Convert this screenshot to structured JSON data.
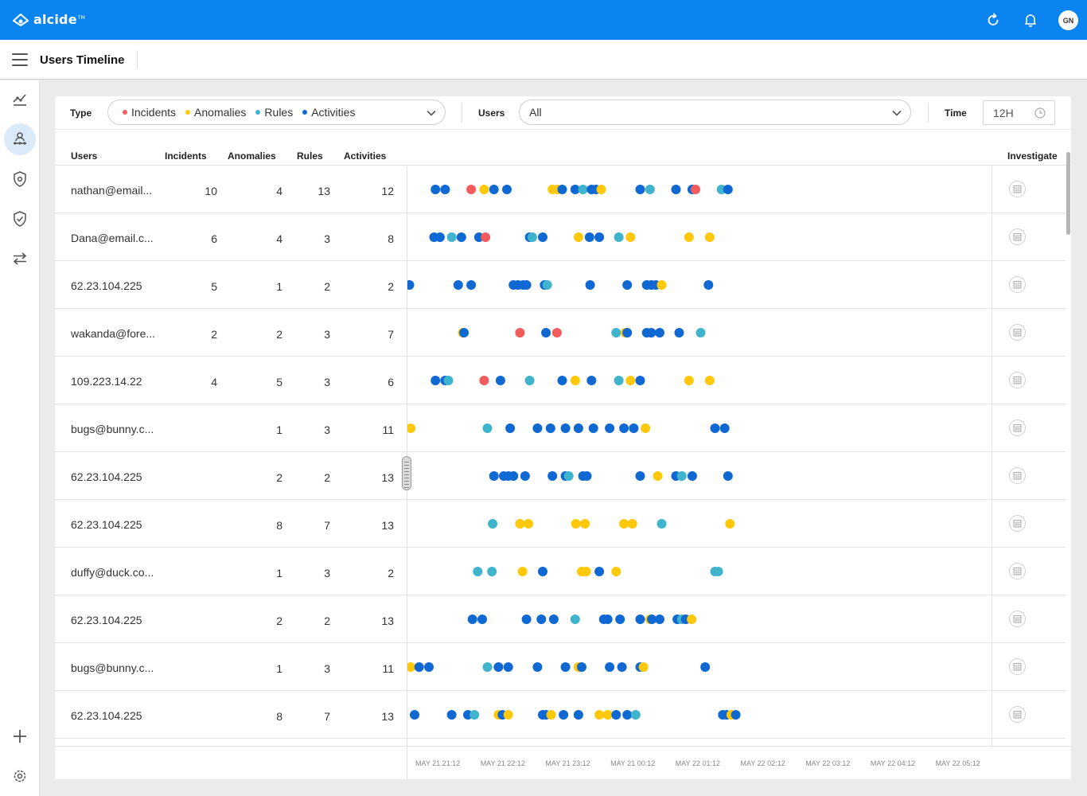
{
  "app": {
    "brand": "alcide",
    "brand_mark": "TM",
    "avatar_initials": "GN",
    "page_title": "Users Timeline"
  },
  "topbar_icons": [
    "refresh-icon",
    "bell-icon"
  ],
  "sidebar_icons": [
    "analytics-icon",
    "users-timeline-icon",
    "shield-gear-icon",
    "shield-check-icon",
    "transfer-icon",
    "plus-icon",
    "settings-icon"
  ],
  "filters": {
    "type_label": "Type",
    "legend": [
      {
        "label": "Incidents",
        "color": "#f25c5c"
      },
      {
        "label": "Anomalies",
        "color": "#ffc80a"
      },
      {
        "label": "Rules",
        "color": "#40b4cc"
      },
      {
        "label": "Activities",
        "color": "#1068d2"
      }
    ],
    "users_label": "Users",
    "users_value": "All",
    "time_label": "Time",
    "time_value": "12H"
  },
  "table": {
    "headers": {
      "users": "Users",
      "incidents": "Incidents",
      "anomalies": "Anomalies",
      "rules": "Rules",
      "activities": "Activities",
      "investigate": "Investigate"
    },
    "rows": [
      {
        "user": "nathan@email...",
        "incidents": "10",
        "anomalies": "4",
        "rules": "13",
        "activities": "12"
      },
      {
        "user": "Dana@email.c...",
        "incidents": "6",
        "anomalies": "4",
        "rules": "3",
        "activities": "8"
      },
      {
        "user": "62.23.104.225",
        "incidents": "5",
        "anomalies": "1",
        "rules": "2",
        "activities": "2"
      },
      {
        "user": "wakanda@fore...",
        "incidents": "2",
        "anomalies": "2",
        "rules": "3",
        "activities": "7"
      },
      {
        "user": "109.223.14.22",
        "incidents": "4",
        "anomalies": "5",
        "rules": "3",
        "activities": "6"
      },
      {
        "user": "bugs@bunny.c...",
        "incidents": "",
        "anomalies": "1",
        "rules": "3",
        "activities": "11"
      },
      {
        "user": "62.23.104.225",
        "incidents": "",
        "anomalies": "2",
        "rules": "2",
        "activities": "13"
      },
      {
        "user": "62.23.104.225",
        "incidents": "",
        "anomalies": "8",
        "rules": "7",
        "activities": "13"
      },
      {
        "user": "duffy@duck.co...",
        "incidents": "",
        "anomalies": "1",
        "rules": "3",
        "activities": "2"
      },
      {
        "user": "62.23.104.225",
        "incidents": "",
        "anomalies": "2",
        "rules": "2",
        "activities": "13"
      },
      {
        "user": "bugs@bunny.c...",
        "incidents": "",
        "anomalies": "1",
        "rules": "3",
        "activities": "11"
      },
      {
        "user": "62.23.104.225",
        "incidents": "",
        "anomalies": "8",
        "rules": "7",
        "activities": "13"
      }
    ]
  },
  "timeline": {
    "axis_labels": [
      "MAY 21 21:12",
      "MAY 21 22:12",
      "MAY 21 23:12",
      "MAY 21 00:12",
      "MAY 22 01:12",
      "MAY 22 02:12",
      "MAY 22 03:12",
      "MAY 22 04:12",
      "MAY 22 05:12"
    ],
    "events": [
      [
        [
          "a",
          21.3
        ],
        [
          "a",
          21.45
        ],
        [
          "i",
          21.85
        ],
        [
          "n",
          22.05
        ],
        [
          "a",
          22.2
        ],
        [
          "a",
          22.4
        ],
        [
          "n",
          23.1
        ],
        [
          "n",
          23.18
        ],
        [
          "a",
          23.25
        ],
        [
          "a",
          23.45
        ],
        [
          "r",
          23.57
        ],
        [
          "a",
          23.7
        ],
        [
          "a",
          23.77
        ],
        [
          "n",
          23.85
        ],
        [
          "a",
          24.45
        ],
        [
          "r",
          24.6
        ],
        [
          "a",
          25.0
        ],
        [
          "a",
          25.25
        ],
        [
          "i",
          25.3
        ],
        [
          "r",
          25.7
        ],
        [
          "a",
          25.8
        ]
      ],
      [
        [
          "a",
          21.28
        ],
        [
          "a",
          21.37
        ],
        [
          "r",
          21.55
        ],
        [
          "a",
          21.7
        ],
        [
          "a",
          21.97
        ],
        [
          "i",
          22.07
        ],
        [
          "a",
          22.75
        ],
        [
          "r",
          22.79
        ],
        [
          "a",
          22.95
        ],
        [
          "n",
          23.5
        ],
        [
          "a",
          23.67
        ],
        [
          "a",
          23.82
        ],
        [
          "r",
          24.12
        ],
        [
          "n",
          24.3
        ],
        [
          "n",
          25.2
        ],
        [
          "n",
          25.52
        ]
      ],
      [
        [
          "a",
          20.75
        ],
        [
          "a",
          20.9
        ],
        [
          "a",
          21.65
        ],
        [
          "a",
          21.85
        ],
        [
          "a",
          22.5
        ],
        [
          "a",
          22.57
        ],
        [
          "a",
          22.65
        ],
        [
          "a",
          22.7
        ],
        [
          "a",
          22.98
        ],
        [
          "r",
          23.02
        ],
        [
          "a",
          23.68
        ],
        [
          "a",
          24.25
        ],
        [
          "a",
          24.55
        ],
        [
          "a",
          24.62
        ],
        [
          "a",
          24.69
        ],
        [
          "n",
          24.78
        ],
        [
          "a",
          25.5
        ]
      ],
      [
        [
          "n",
          21.72
        ],
        [
          "a",
          21.74
        ],
        [
          "i",
          22.6
        ],
        [
          "a",
          23.0
        ],
        [
          "i",
          23.17
        ],
        [
          "r",
          24.08
        ],
        [
          "n",
          24.22
        ],
        [
          "a",
          24.25
        ],
        [
          "a",
          24.55
        ],
        [
          "a",
          24.62
        ],
        [
          "a",
          24.75
        ],
        [
          "a",
          25.05
        ],
        [
          "r",
          25.38
        ]
      ],
      [
        [
          "a",
          21.3
        ],
        [
          "a",
          21.45
        ],
        [
          "r",
          21.5
        ],
        [
          "i",
          22.05
        ],
        [
          "a",
          22.3
        ],
        [
          "r",
          22.75
        ],
        [
          "a",
          23.25
        ],
        [
          "n",
          23.45
        ],
        [
          "a",
          23.7
        ],
        [
          "r",
          24.12
        ],
        [
          "n",
          24.3
        ],
        [
          "a",
          24.45
        ],
        [
          "n",
          25.2
        ],
        [
          "n",
          25.52
        ]
      ],
      [
        [
          "n",
          20.92
        ],
        [
          "r",
          22.1
        ],
        [
          "a",
          22.45
        ],
        [
          "a",
          22.87
        ],
        [
          "a",
          23.07
        ],
        [
          "a",
          23.3
        ],
        [
          "n",
          23.5
        ],
        [
          "a",
          23.5
        ],
        [
          "a",
          23.73
        ],
        [
          "a",
          23.98
        ],
        [
          "a",
          24.2
        ],
        [
          "a",
          24.35
        ],
        [
          "n",
          24.53
        ],
        [
          "a",
          25.6
        ],
        [
          "a",
          25.75
        ]
      ],
      [
        [
          "a",
          22.2
        ],
        [
          "a",
          22.35
        ],
        [
          "a",
          22.42
        ],
        [
          "a",
          22.5
        ],
        [
          "a",
          22.68
        ],
        [
          "a",
          23.1
        ],
        [
          "a",
          23.3
        ],
        [
          "r",
          23.35
        ],
        [
          "a",
          23.57
        ],
        [
          "a",
          23.63
        ],
        [
          "a",
          24.45
        ],
        [
          "n",
          24.72
        ],
        [
          "a",
          25.0
        ],
        [
          "r",
          25.09
        ],
        [
          "a",
          25.25
        ],
        [
          "a",
          25.8
        ]
      ],
      [
        [
          "n",
          20.7
        ],
        [
          "r",
          22.18
        ],
        [
          "n",
          22.6
        ],
        [
          "n",
          22.73
        ],
        [
          "n",
          23.46
        ],
        [
          "n",
          23.6
        ],
        [
          "n",
          24.2
        ],
        [
          "n",
          24.33
        ],
        [
          "r",
          24.78
        ],
        [
          "n",
          25.83
        ]
      ],
      [
        [
          "r",
          21.95
        ],
        [
          "r",
          22.17
        ],
        [
          "n",
          22.64
        ],
        [
          "a",
          22.95
        ],
        [
          "n",
          23.55
        ],
        [
          "n",
          23.62
        ],
        [
          "a",
          23.82
        ],
        [
          "n",
          24.08
        ],
        [
          "r",
          25.6
        ],
        [
          "r",
          25.65
        ]
      ],
      [
        [
          "a",
          21.87
        ],
        [
          "a",
          22.02
        ],
        [
          "a",
          22.7
        ],
        [
          "a",
          22.93
        ],
        [
          "a",
          23.12
        ],
        [
          "r",
          23.45
        ],
        [
          "a",
          23.89
        ],
        [
          "a",
          23.95
        ],
        [
          "a",
          24.14
        ],
        [
          "a",
          24.45
        ],
        [
          "n",
          24.6
        ],
        [
          "a",
          24.63
        ],
        [
          "a",
          24.75
        ],
        [
          "a",
          25.02
        ],
        [
          "r",
          25.09
        ],
        [
          "a",
          25.15
        ],
        [
          "n",
          25.24
        ]
      ],
      [
        [
          "n",
          20.92
        ],
        [
          "a",
          21.05
        ],
        [
          "a",
          21.2
        ],
        [
          "r",
          22.1
        ],
        [
          "a",
          22.27
        ],
        [
          "a",
          22.42
        ],
        [
          "a",
          22.87
        ],
        [
          "a",
          23.3
        ],
        [
          "n",
          23.5
        ],
        [
          "a",
          23.55
        ],
        [
          "a",
          23.98
        ],
        [
          "a",
          24.17
        ],
        [
          "a",
          24.45
        ],
        [
          "n",
          24.5
        ],
        [
          "a",
          25.45
        ]
      ],
      [
        [
          "n",
          20.7
        ],
        [
          "a",
          20.98
        ],
        [
          "a",
          21.55
        ],
        [
          "a",
          21.8
        ],
        [
          "r",
          21.9
        ],
        [
          "n",
          22.27
        ],
        [
          "a",
          22.33
        ],
        [
          "n",
          22.42
        ],
        [
          "a",
          22.95
        ],
        [
          "a",
          23.0
        ],
        [
          "n",
          23.08
        ],
        [
          "a",
          23.27
        ],
        [
          "n",
          23.5
        ],
        [
          "a",
          23.5
        ],
        [
          "n",
          23.82
        ],
        [
          "n",
          23.95
        ],
        [
          "a",
          24.08
        ],
        [
          "a",
          24.25
        ],
        [
          "r",
          24.38
        ],
        [
          "a",
          25.72
        ],
        [
          "a",
          25.78
        ],
        [
          "n",
          25.85
        ],
        [
          "a",
          25.92
        ]
      ]
    ]
  }
}
